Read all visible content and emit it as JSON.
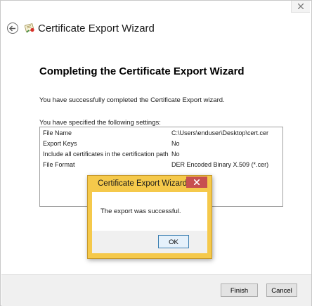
{
  "window": {
    "title": "Certificate Export Wizard"
  },
  "page": {
    "heading": "Completing the Certificate Export Wizard",
    "success_text": "You have successfully completed the Certificate Export wizard.",
    "settings_intro": "You have specified the following settings:",
    "settings": [
      {
        "key": "File Name",
        "value": "C:\\Users\\enduser\\Desktop\\cert.cer"
      },
      {
        "key": "Export Keys",
        "value": "No"
      },
      {
        "key": "Include all certificates in the certification path",
        "value": "No"
      },
      {
        "key": "File Format",
        "value": "DER Encoded Binary X.509 (*.cer)"
      }
    ]
  },
  "buttons": {
    "finish": "Finish",
    "cancel": "Cancel"
  },
  "dialog": {
    "title": "Certificate Export Wizard",
    "message": "The export was successful.",
    "ok": "OK"
  },
  "icons": {
    "back": "back-arrow-icon",
    "certificate": "certificate-icon",
    "close": "close-icon"
  },
  "colors": {
    "dialog_frame": "#f5c94b",
    "dialog_close": "#c75050",
    "ok_border": "#3c7fb1"
  }
}
